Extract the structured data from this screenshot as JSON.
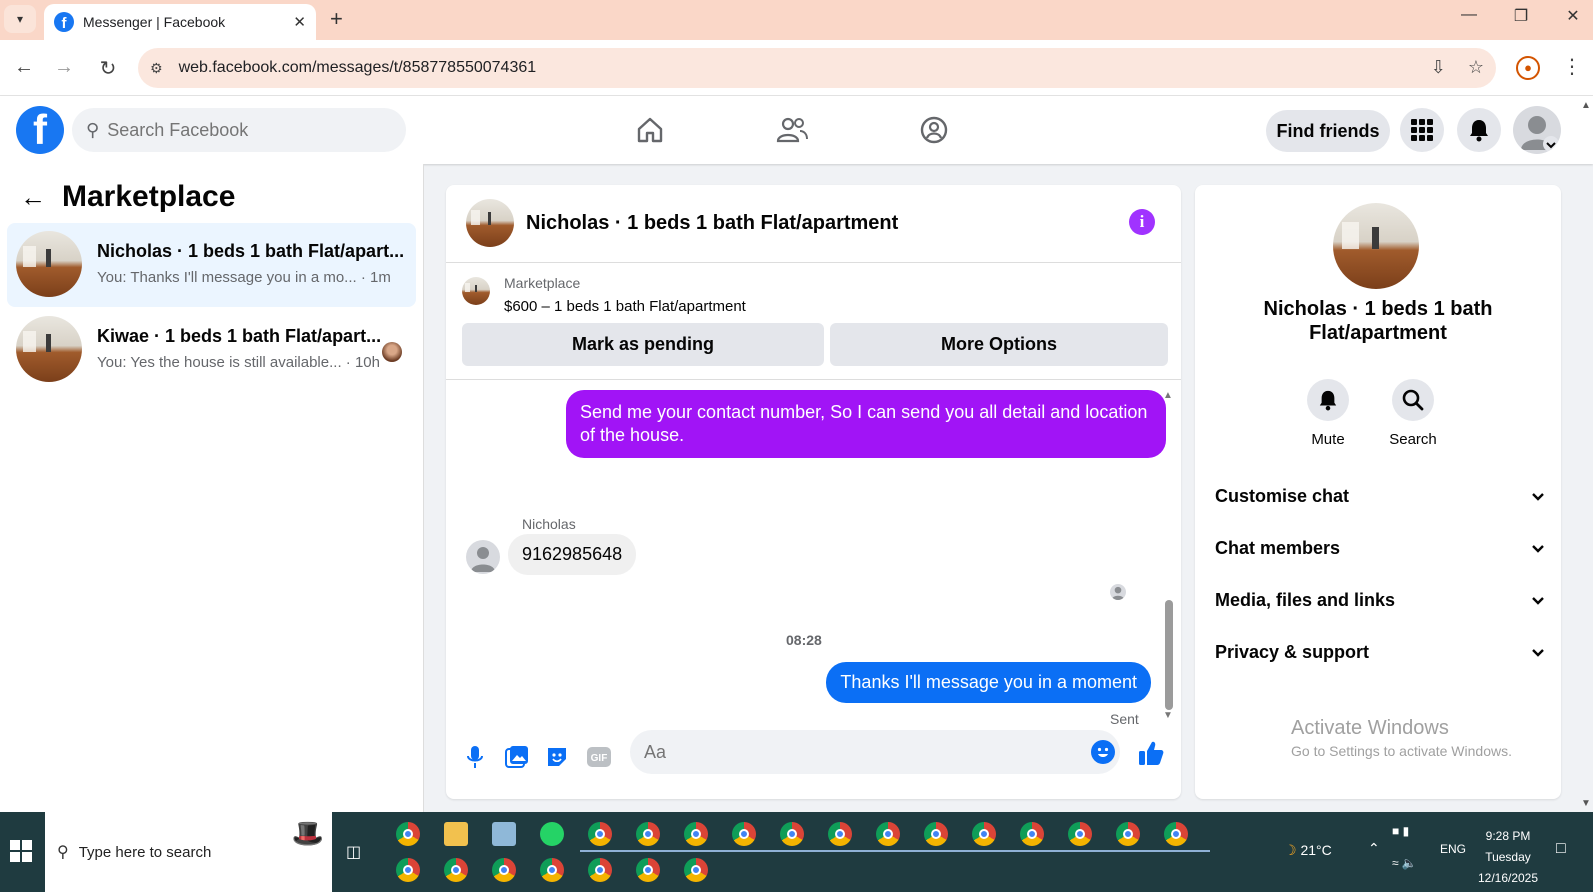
{
  "browser": {
    "tab_title": "Messenger | Facebook",
    "url": "web.facebook.com/messages/t/858778550074361"
  },
  "fb": {
    "search_placeholder": "Search Facebook",
    "find_friends": "Find friends"
  },
  "sidebar": {
    "title": "Marketplace",
    "conversations": [
      {
        "name": "Nicholas · 1 beds 1 bath Flat/apart...",
        "preview": "You: Thanks I'll message you in a mo... · 1m"
      },
      {
        "name": "Kiwae · 1 beds 1 bath Flat/apart...",
        "preview": "You: Yes the house is still available... · 10h"
      }
    ]
  },
  "chat": {
    "title": "Nicholas · 1 beds 1 bath Flat/apartment",
    "marketplace_label": "Marketplace",
    "listing": "$600 – 1 beds 1 bath Flat/apartment",
    "mark_pending": "Mark as pending",
    "more_options": "More Options",
    "messages": {
      "out1": "Send me your contact number, So I can send you all detail and location of the house.",
      "sender": "Nicholas",
      "in1": "9162985648",
      "time": "08:28",
      "out2": "Thanks I'll message you in a moment",
      "status": "Sent"
    },
    "composer_placeholder": "Aa"
  },
  "details": {
    "name": "Nicholas · 1 beds 1 bath Flat/apartment",
    "mute": "Mute",
    "search": "Search",
    "sections": [
      "Customise chat",
      "Chat members",
      "Media, files and links",
      "Privacy & support"
    ],
    "activate_title": "Activate Windows",
    "activate_sub": "Go to Settings to activate Windows."
  },
  "taskbar": {
    "search_text": "Type here to search",
    "weather": "21°C",
    "lang": "ENG",
    "time": "9:28 PM",
    "day": "Tuesday",
    "date": "12/16/2025"
  },
  "colors": {
    "fb_blue": "#1877f2",
    "bubble_purple": "#a114f6",
    "bubble_blue": "#0b6ff5",
    "info_purple": "#a033ff"
  }
}
